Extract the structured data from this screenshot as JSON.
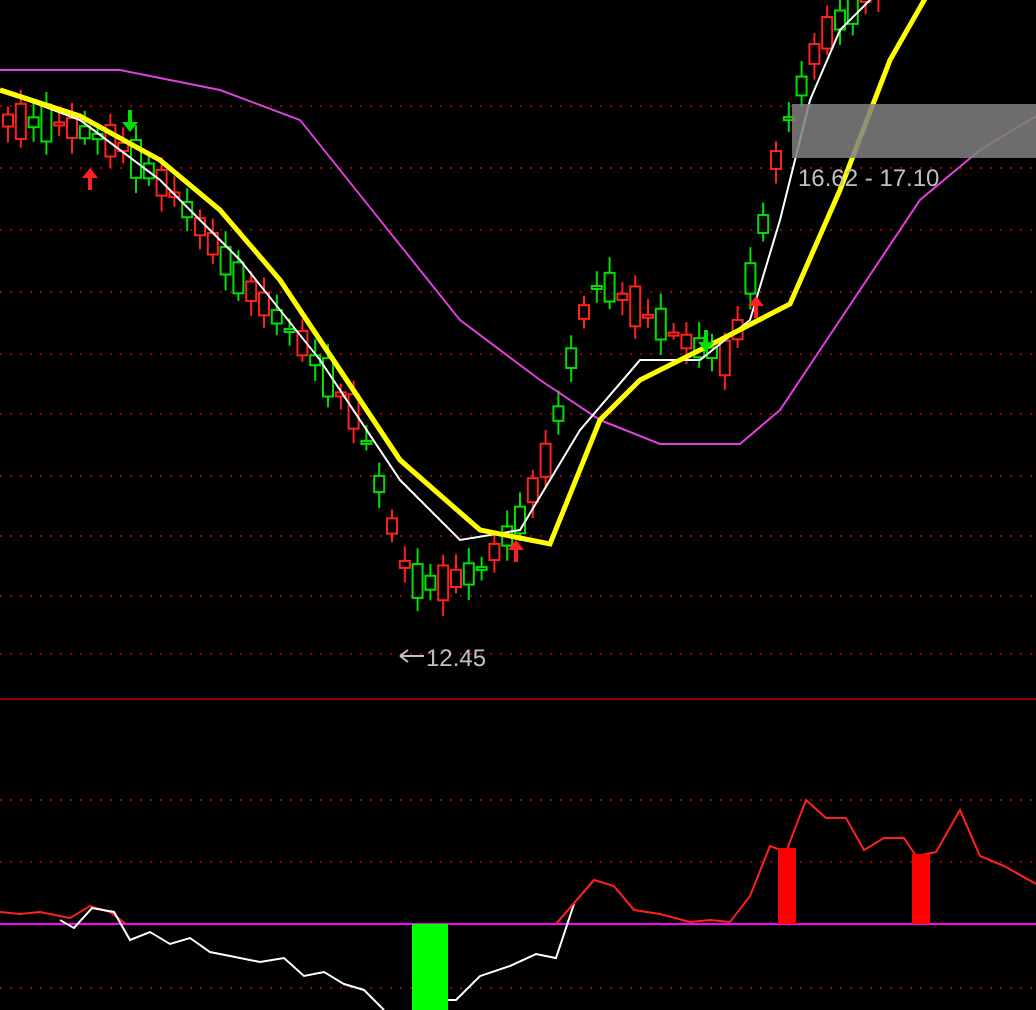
{
  "price_range_label": "16.62 - 17.10",
  "low_label": "12.45"
}
